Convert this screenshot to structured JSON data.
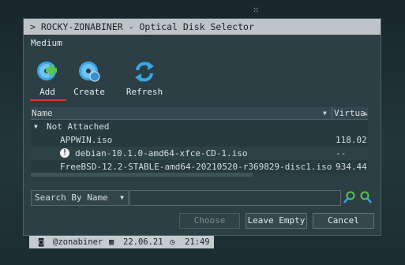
{
  "window": {
    "title": "> ROCKY-ZONABINER - Optical Disk Selector"
  },
  "section_label": "Medium",
  "toolbar": {
    "add_label": "Add",
    "create_label": "Create",
    "refresh_label": "Refresh"
  },
  "table": {
    "columns": [
      "Name",
      "Virtua"
    ],
    "group": "Not Attached",
    "rows": [
      {
        "name": "APPWIN.iso",
        "size": "118.02",
        "warning": false
      },
      {
        "name": "debian-10.1.0-amd64-xfce-CD-1.iso",
        "size": "--",
        "warning": true
      },
      {
        "name": "FreeBSD-12.2-STABLE-amd64-20210520-r369829-disc1.iso",
        "size": "934.44",
        "warning": false
      }
    ]
  },
  "search": {
    "mode_label": "Search By Name",
    "value": "",
    "placeholder": ""
  },
  "buttons": {
    "choose": "Choose",
    "leave_empty": "Leave Empty",
    "cancel": "Cancel"
  },
  "taskbar": {
    "user": "@zonabiner",
    "date": "22.06.21",
    "time": "21:49"
  },
  "colors": {
    "accent_underline": "#d23a2f",
    "icon_blue": "#39a6e6",
    "icon_green": "#5bc54a"
  },
  "icons": {
    "add": "disk-add-icon",
    "create": "disk-create-icon",
    "refresh": "refresh-icon",
    "warning": "warning-icon",
    "search_forward": "search-forward-icon",
    "search_backward": "search-backward-icon"
  }
}
